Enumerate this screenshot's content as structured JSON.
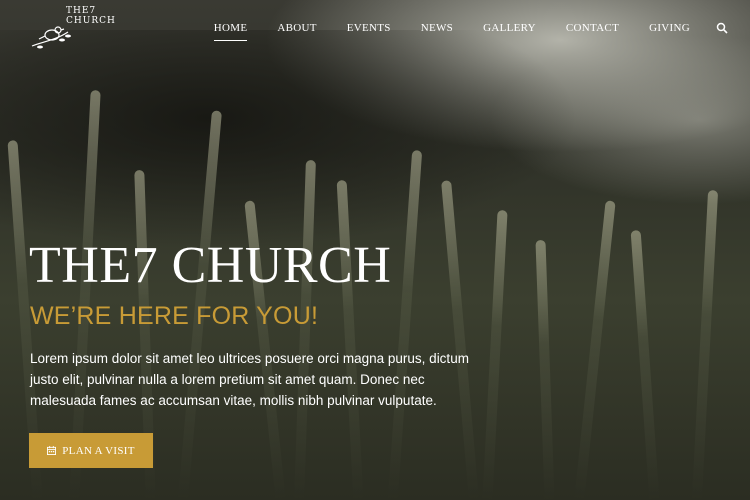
{
  "brand": {
    "logo_text": "THE7 CHURCH",
    "icon": "bird-on-branch-logo"
  },
  "nav": {
    "items": [
      {
        "label": "HOME",
        "active": true
      },
      {
        "label": "ABOUT",
        "active": false
      },
      {
        "label": "EVENTS",
        "active": false
      },
      {
        "label": "NEWS",
        "active": false
      },
      {
        "label": "GALLERY",
        "active": false
      },
      {
        "label": "CONTACT",
        "active": false
      },
      {
        "label": "GIVING",
        "active": false
      }
    ],
    "search_icon": "search-icon"
  },
  "hero": {
    "title": "THE7 CHURCH",
    "subtitle": "WE’RE HERE FOR YOU!",
    "text": "Lorem ipsum dolor sit amet leo ultrices posuere orci magna purus, dictum justo elit, pulvinar nulla a lorem pretium sit amet quam. Donec nec malesuada fames ac accumsan vitae, mollis nibh pulvinar vulputate.",
    "cta_label": "PLAN A VISIT",
    "cta_icon": "calendar-icon"
  },
  "colors": {
    "accent": "#c89b36",
    "text": "#ffffff"
  }
}
